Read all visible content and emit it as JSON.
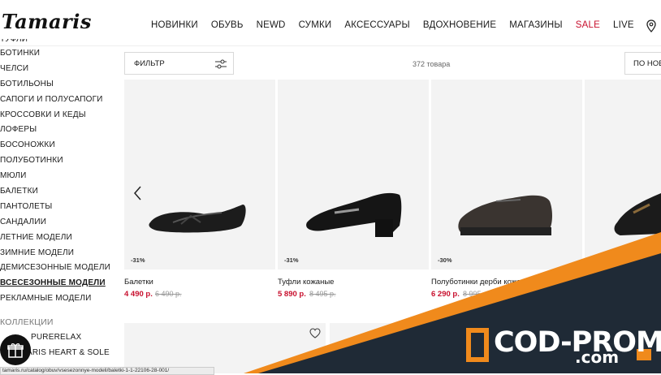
{
  "header": {
    "logo": "Tamaris",
    "nav": [
      "НОВИНКИ",
      "ОБУВЬ",
      "NEWD",
      "СУМКИ",
      "АКСЕССУАРЫ",
      "ВДОХНОВЕНИЕ",
      "МАГАЗИНЫ",
      "SALE",
      "LIVE"
    ],
    "sale_color": "#c8102e"
  },
  "sidebar": {
    "items": [
      "ТУФЛИ",
      "БОТИНКИ",
      "ЧЕЛСИ",
      "БОТИЛЬОНЫ",
      "САПОГИ И ПОЛУСАПОГИ",
      "КРОССОВКИ И КЕДЫ",
      "ЛОФЕРЫ",
      "БОСОНОЖКИ",
      "ПОЛУБОТИНКИ",
      "МЮЛИ",
      "БАЛЕТКИ",
      "ПАНТОЛЕТЫ",
      "САНДАЛИИ",
      "ЛЕТНИЕ МОДЕЛИ",
      "ЗИМНИЕ МОДЕЛИ",
      "ДЕМИСЕЗОННЫЕ МОДЕЛИ",
      "ВСЕСЕЗОННЫЕ МОДЕЛИ",
      "РЕКЛАМНЫЕ МОДЕЛИ"
    ],
    "active_index": 16,
    "collections_heading": "КОЛЛЕКЦИИ",
    "collections": [
      "PURERELAX",
      "TAMARIS HEART & SOLE"
    ]
  },
  "toolbar": {
    "filter_label": "ФИЛЬТР",
    "count": "372 товара",
    "sort_label": "ПО НОВИЗНЕ"
  },
  "products": [
    {
      "name": "Балетки",
      "price": "4 490 р.",
      "old_price": "6 490 р.",
      "badge": "-31%"
    },
    {
      "name": "Туфли кожаные",
      "price": "5 890 р.",
      "old_price": "8 495 р.",
      "badge": "-31%"
    },
    {
      "name": "Полуботинки дерби кожаные",
      "price": "6 290 р.",
      "old_price": "8 995 р.",
      "badge": "-30%"
    }
  ],
  "status_url": "tamaris.ru/catalog/obuv/vsesezonnye-modeli/baletki-1-1-22106-28-001/",
  "promo": {
    "main": "COD-PROMO",
    "sub": ".com",
    "bg": "#1f2a36",
    "accent": "#f08a1c"
  }
}
